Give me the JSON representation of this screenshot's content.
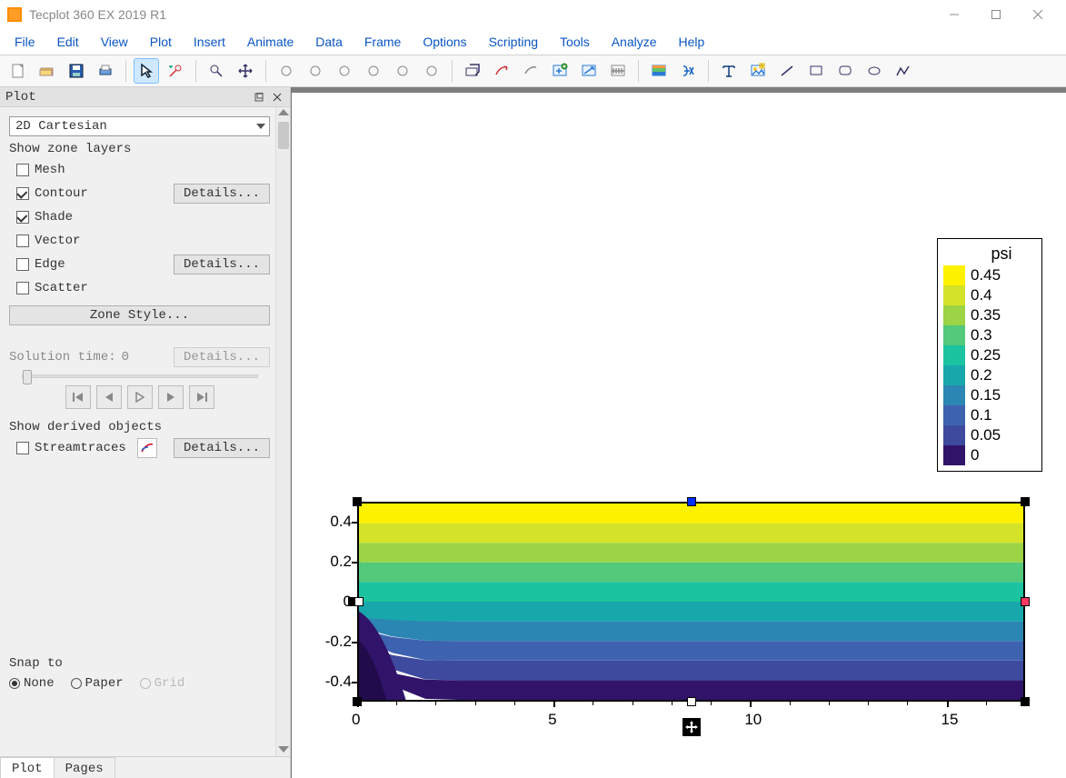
{
  "app": {
    "title": "Tecplot 360 EX 2019 R1"
  },
  "menus": [
    "File",
    "Edit",
    "View",
    "Plot",
    "Insert",
    "Animate",
    "Data",
    "Frame",
    "Options",
    "Scripting",
    "Tools",
    "Analyze",
    "Help"
  ],
  "toolbar": {
    "groups": [
      [
        "new",
        "open",
        "save",
        "print"
      ],
      [
        "pointer",
        "probe"
      ],
      [
        "zoom",
        "pan"
      ],
      [
        "rotate-xyz",
        "rotate-x",
        "rotate-y",
        "rotate-xy",
        "rotate-yz",
        "rotate-z"
      ],
      [
        "slice",
        "streamtrace",
        "iso",
        "extract",
        "vector",
        "contour-adj"
      ],
      [
        "zone",
        "fx"
      ],
      [
        "text",
        "image",
        "line",
        "rect",
        "rounded-rect",
        "ellipse",
        "polyline"
      ]
    ],
    "selected": "pointer"
  },
  "side": {
    "panel_title": "Plot",
    "plot_type": "2D Cartesian",
    "layers_label": "Show zone layers",
    "layers": [
      {
        "key": "mesh",
        "label": "Mesh",
        "checked": false
      },
      {
        "key": "contour",
        "label": "Contour",
        "checked": true,
        "details": true
      },
      {
        "key": "shade",
        "label": "Shade",
        "checked": true
      },
      {
        "key": "vector",
        "label": "Vector",
        "checked": false
      },
      {
        "key": "edge",
        "label": "Edge",
        "checked": false,
        "details": true
      },
      {
        "key": "scatter",
        "label": "Scatter",
        "checked": false
      }
    ],
    "zone_style_label": "Zone Style...",
    "details_label": "Details...",
    "solution_time_label": "Solution time:",
    "solution_time_value": "0",
    "derived_label": "Show derived objects",
    "streamtraces_label": "Streamtraces",
    "snap_label": "Snap to",
    "snap_options": [
      {
        "key": "none",
        "label": "None",
        "checked": true
      },
      {
        "key": "paper",
        "label": "Paper",
        "checked": false
      },
      {
        "key": "grid",
        "label": "Grid",
        "checked": false,
        "disabled": true
      }
    ],
    "tabs": [
      {
        "key": "plot",
        "label": "Plot",
        "active": true
      },
      {
        "key": "pages",
        "label": "Pages",
        "active": false
      }
    ]
  },
  "chart_data": {
    "type": "heatmap",
    "title": "",
    "variable": "psi",
    "xlabel": "",
    "ylabel": "",
    "xlim": [
      0,
      17
    ],
    "ylim": [
      -0.5,
      0.5
    ],
    "x_ticks": [
      0,
      5,
      10,
      15
    ],
    "y_ticks": [
      -0.4,
      -0.2,
      0,
      0.2,
      0.4
    ],
    "contour_levels": [
      0,
      0.05,
      0.1,
      0.15,
      0.2,
      0.25,
      0.3,
      0.35,
      0.4,
      0.45
    ],
    "colorbar": [
      {
        "value": 0.45,
        "color": "#fff200"
      },
      {
        "value": 0.4,
        "color": "#d4e22a"
      },
      {
        "value": 0.35,
        "color": "#9bd445"
      },
      {
        "value": 0.3,
        "color": "#52c97b"
      },
      {
        "value": 0.25,
        "color": "#1cc3a0"
      },
      {
        "value": 0.2,
        "color": "#18a8ab"
      },
      {
        "value": 0.15,
        "color": "#2c86b4"
      },
      {
        "value": 0.1,
        "color": "#3d63b0"
      },
      {
        "value": 0.05,
        "color": "#3e4a9d"
      },
      {
        "value": 0,
        "color": "#31146a"
      }
    ],
    "legend_title": "psi",
    "description": "Filled contour plot of psi over x∈[0,17], y∈[-0.5,0.5]. Far from the inlet (x≳2) psi is essentially a function of y only, increasing roughly linearly from ≈0 at the bottom wall to ≈0.5 at the top wall. Near the inlet (x≲1) there is a small recirculation pocket at the lower-left corner where psi≈0 extends up to about y≈-0.05 at x=0, after which the contour lines curve down to the bottom wall by x≈1–2."
  }
}
